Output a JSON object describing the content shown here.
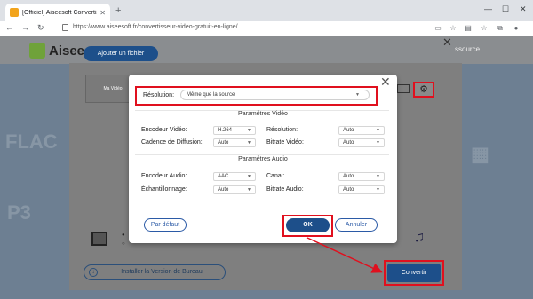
{
  "browser": {
    "tab_title": "[Officiel] Aiseesoft Convertisseu...",
    "url": "https://www.aiseesoft.fr/convertisseur-video-gratuit-en-ligne/"
  },
  "page": {
    "brand": "Aisee",
    "ressource": "ssource",
    "add_file": "Ajouter un fichier",
    "video_label": "Ma Vidéo",
    "install": "Installer la Version de Bureau",
    "convert": "Convertir"
  },
  "modal": {
    "resolution_label": "Résolution:",
    "resolution_value": "Même que la source",
    "video_section": "Paramètres Vidéo",
    "audio_section": "Paramètres Audio",
    "video_fields": [
      {
        "label": "Encodeur Vidéo:",
        "value": "H.264"
      },
      {
        "label": "Résolution:",
        "value": "Auto"
      },
      {
        "label": "Cadence de Diffusion:",
        "value": "Auto"
      },
      {
        "label": "Bitrate Vidéo:",
        "value": "Auto"
      }
    ],
    "audio_fields": [
      {
        "label": "Encodeur Audio:",
        "value": "AAC"
      },
      {
        "label": "Canal:",
        "value": "Auto"
      },
      {
        "label": "Échantillonnage:",
        "value": "Auto"
      },
      {
        "label": "Bitrate Audio:",
        "value": "Auto"
      }
    ],
    "default_btn": "Par défaut",
    "ok_btn": "OK",
    "cancel_btn": "Annuler"
  },
  "colors": {
    "accent": "#1d4f8a",
    "highlight": "#e0101e"
  }
}
